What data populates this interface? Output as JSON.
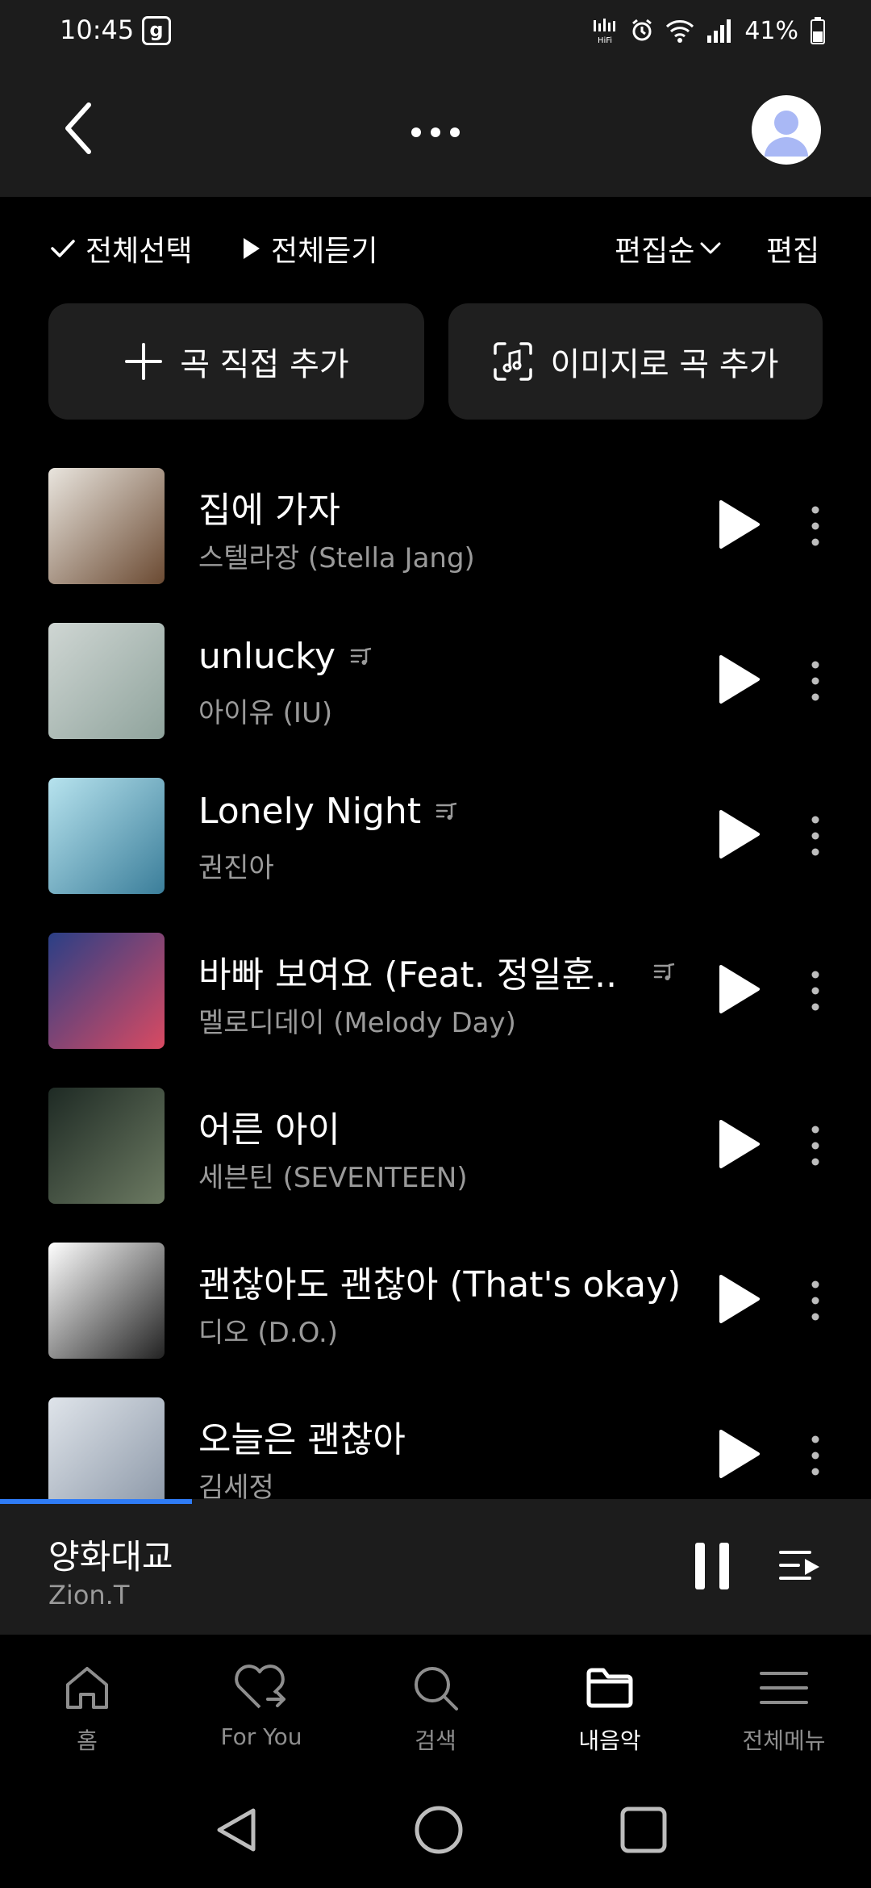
{
  "status_bar": {
    "time": "10:45",
    "badge": "g",
    "battery_percent": "41%"
  },
  "header": {
    "menu_dots": "..."
  },
  "toolbar": {
    "select_all": "전체선택",
    "play_all": "전체듣기",
    "sort": "편집순",
    "edit": "편집"
  },
  "add_buttons": {
    "direct": "곡 직접 추가",
    "image": "이미지로 곡 추가"
  },
  "songs": [
    {
      "title": "집에 가자",
      "artist": "스텔라장 (Stella Jang)",
      "lyrics": false,
      "art_colors": [
        "#e9e5de",
        "#6b4a32"
      ]
    },
    {
      "title": "unlucky",
      "artist": "아이유 (IU)",
      "lyrics": true,
      "art_colors": [
        "#cfd6d3",
        "#8fa39c"
      ]
    },
    {
      "title": "Lonely Night",
      "artist": "권진아",
      "lyrics": true,
      "art_colors": [
        "#b7e3ee",
        "#3b7e9a"
      ]
    },
    {
      "title": "바빠 보여요 (Feat. 정일훈..",
      "artist": "멜로디데이 (Melody Day)",
      "lyrics": true,
      "art_colors": [
        "#2a3f86",
        "#d94a62"
      ]
    },
    {
      "title": "어른 아이",
      "artist": "세븐틴 (SEVENTEEN)",
      "lyrics": false,
      "art_colors": [
        "#1e2a24",
        "#6c7a62"
      ]
    },
    {
      "title": "괜찮아도 괜찮아 (That's okay)",
      "artist": "디오 (D.O.)",
      "lyrics": false,
      "art_colors": [
        "#ffffff",
        "#222222"
      ]
    },
    {
      "title": "오늘은 괜찮아",
      "artist": "김세정",
      "lyrics": false,
      "art_colors": [
        "#dfe4ea",
        "#8a96a6"
      ]
    }
  ],
  "mini_player": {
    "title": "양화대교",
    "artist": "Zion.T",
    "progress": 0.22,
    "accent": "#2f7cf6"
  },
  "bottom_nav": [
    {
      "label": "홈",
      "icon": "home-icon",
      "active": false
    },
    {
      "label": "For You",
      "icon": "heart-icon",
      "active": false
    },
    {
      "label": "검색",
      "icon": "search-icon",
      "active": false
    },
    {
      "label": "내음악",
      "icon": "folder-icon",
      "active": true
    },
    {
      "label": "전체메뉴",
      "icon": "menu-icon",
      "active": false
    }
  ]
}
